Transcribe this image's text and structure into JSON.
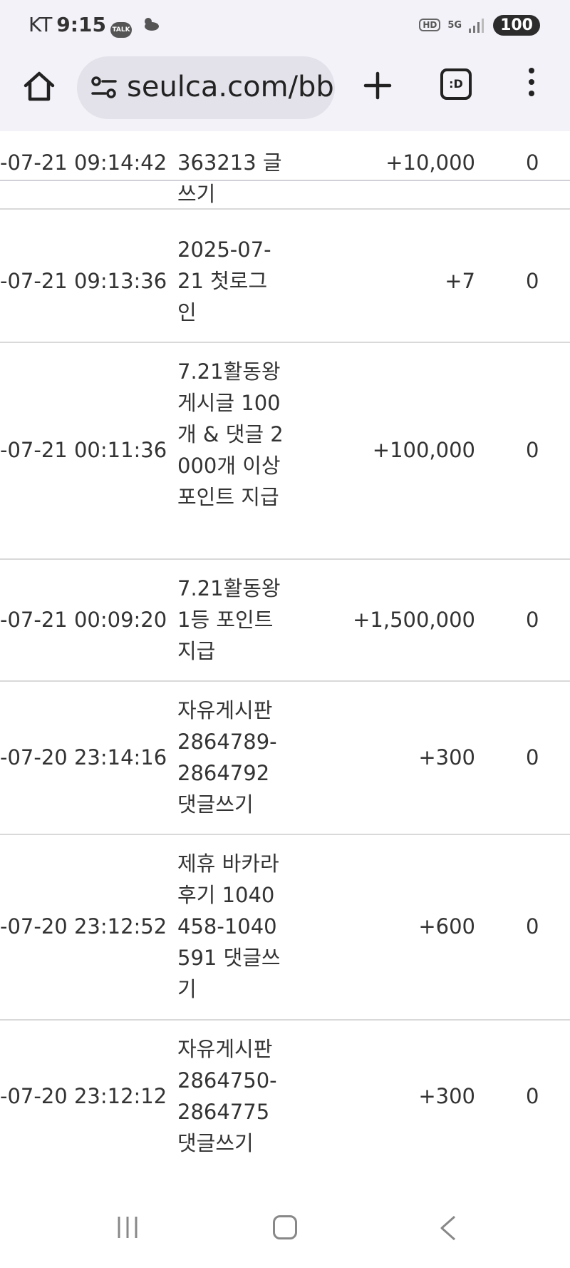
{
  "status": {
    "carrier": "KT",
    "time": "9:15",
    "talk_badge": "TALK",
    "hd": "HD",
    "network": "5G",
    "battery": "100"
  },
  "browser": {
    "url": "seulca.com/bbs",
    "tabs_label": ":D"
  },
  "rows": [
    {
      "date": "-07-21 09:14:42",
      "desc": "363213 글쓰기",
      "amount": "+10,000",
      "balance": "0"
    },
    {
      "date": "-07-21 09:13:36",
      "desc": "2025-07-21 첫로그인",
      "amount": "+7",
      "balance": "0"
    },
    {
      "date": "-07-21 00:11:36",
      "desc": "7.21활동왕 게시글 100개 & 댓글 2000개 이상 포인트 지급",
      "amount": "+100,000",
      "balance": "0"
    },
    {
      "date": "-07-21 00:09:20",
      "desc": "7.21활동왕 1등 포인트 지급",
      "amount": "+1,500,000",
      "balance": "0"
    },
    {
      "date": "-07-20 23:14:16",
      "desc": "자유게시판 2864789-2864792 댓글쓰기",
      "amount": "+300",
      "balance": "0"
    },
    {
      "date": "-07-20 23:12:52",
      "desc": "제휴 바카라후기 1040458-1040591 댓글쓰기",
      "amount": "+600",
      "balance": "0"
    },
    {
      "date": "-07-20 23:12:12",
      "desc": "자유게시판 2864750-2864775 댓글쓰기",
      "amount": "+300",
      "balance": "0"
    }
  ]
}
